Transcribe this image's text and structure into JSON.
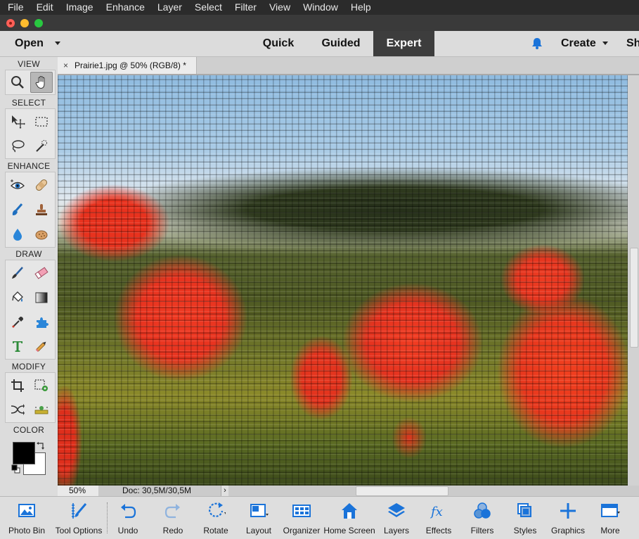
{
  "menubar": {
    "items": [
      "File",
      "Edit",
      "Image",
      "Enhance",
      "Layer",
      "Select",
      "Filter",
      "View",
      "Window",
      "Help"
    ]
  },
  "appbar": {
    "open_label": "Open",
    "modes": [
      "Quick",
      "Guided",
      "Expert"
    ],
    "active_mode": "Expert",
    "create_label": "Create",
    "share_label": "Sh"
  },
  "toolbox": {
    "sections": {
      "view": "VIEW",
      "select": "SELECT",
      "enhance": "ENHANCE",
      "draw": "DRAW",
      "modify": "MODIFY",
      "color": "COLOR"
    },
    "foreground_color": "#000000",
    "background_color": "#ffffff"
  },
  "document": {
    "tab_title": "Prairie1.jpg @ 50% (RGB/8) *",
    "close_glyph": "×"
  },
  "statusbar": {
    "zoom": "50%",
    "doc_info": "Doc: 30,5M/30,5M",
    "arrow": "›"
  },
  "taskbar": {
    "items": [
      "Photo Bin",
      "Tool Options",
      "Undo",
      "Redo",
      "Rotate",
      "Layout",
      "Organizer",
      "Home Screen",
      "Layers",
      "Effects",
      "Filters",
      "Styles",
      "Graphics",
      "More"
    ]
  },
  "colors": {
    "accent": "#1a73d9",
    "mode_active_bg": "#3d3d3d"
  }
}
